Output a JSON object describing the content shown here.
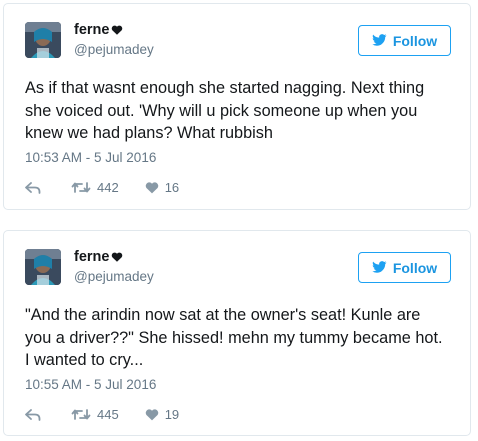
{
  "tweets": [
    {
      "user": {
        "name": "ferne",
        "handle": "@pejumadey"
      },
      "follow_label": "Follow",
      "text": "As if that wasnt enough she started nagging. Next thing she voiced out. 'Why will u pick someone up when you knew we had plans? What rubbish",
      "timestamp": "10:53 AM - 5 Jul 2016",
      "retweets": "442",
      "likes": "16"
    },
    {
      "user": {
        "name": "ferne",
        "handle": "@pejumadey"
      },
      "follow_label": "Follow",
      "text": "\"And the arindin now sat at the owner's seat! Kunle are you a driver??\" She hissed! mehn my tummy became hot. I wanted to cry...",
      "timestamp": "10:55 AM - 5 Jul 2016",
      "retweets": "445",
      "likes": "19"
    }
  ],
  "icons": {
    "name_badge": "heart-icon",
    "follow": "twitter-bird-icon",
    "reply": "reply-icon",
    "retweet": "retweet-icon",
    "like": "heart-icon"
  },
  "colors": {
    "accent": "#1da1f2",
    "muted": "#657786",
    "text": "#14171a",
    "border": "#e1e8ed"
  }
}
